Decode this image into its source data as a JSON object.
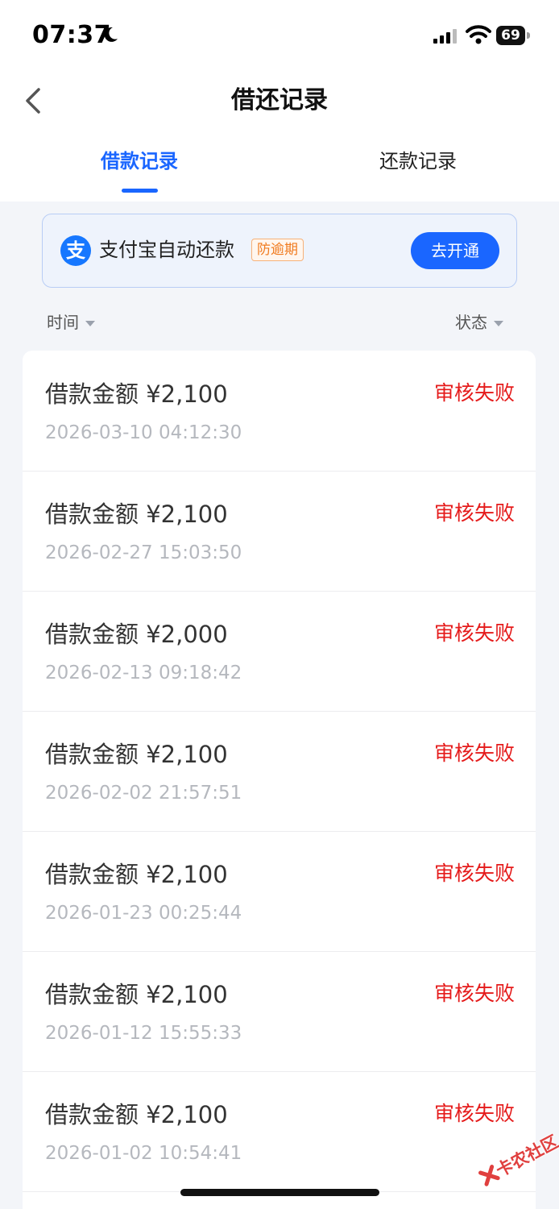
{
  "status_bar": {
    "time": "07:37",
    "battery": "69"
  },
  "nav": {
    "title": "借还记录"
  },
  "tabs": [
    {
      "label": "借款记录",
      "active": true
    },
    {
      "label": "还款记录",
      "active": false
    }
  ],
  "banner": {
    "logo_text": "支",
    "text": "支付宝自动还款",
    "tag": "防逾期",
    "button": "去开通"
  },
  "filters": {
    "time_label": "时间",
    "status_label": "状态"
  },
  "records": [
    {
      "amount": "借款金额 ¥2,100",
      "status": "审核失败",
      "date": "2026-03-10 04:12:30"
    },
    {
      "amount": "借款金额 ¥2,100",
      "status": "审核失败",
      "date": "2026-02-27 15:03:50"
    },
    {
      "amount": "借款金额 ¥2,000",
      "status": "审核失败",
      "date": "2026-02-13 09:18:42"
    },
    {
      "amount": "借款金额 ¥2,100",
      "status": "审核失败",
      "date": "2026-02-02 21:57:51"
    },
    {
      "amount": "借款金额 ¥2,100",
      "status": "审核失败",
      "date": "2026-01-23 00:25:44"
    },
    {
      "amount": "借款金额 ¥2,100",
      "status": "审核失败",
      "date": "2026-01-12 15:55:33"
    },
    {
      "amount": "借款金额 ¥2,100",
      "status": "审核失败",
      "date": "2026-01-02 10:54:41"
    }
  ],
  "watermark": {
    "text": "卡农社区"
  },
  "colors": {
    "accent": "#1a66ff",
    "status_failed": "#e51b1b",
    "tag_orange": "#f07b1f"
  }
}
